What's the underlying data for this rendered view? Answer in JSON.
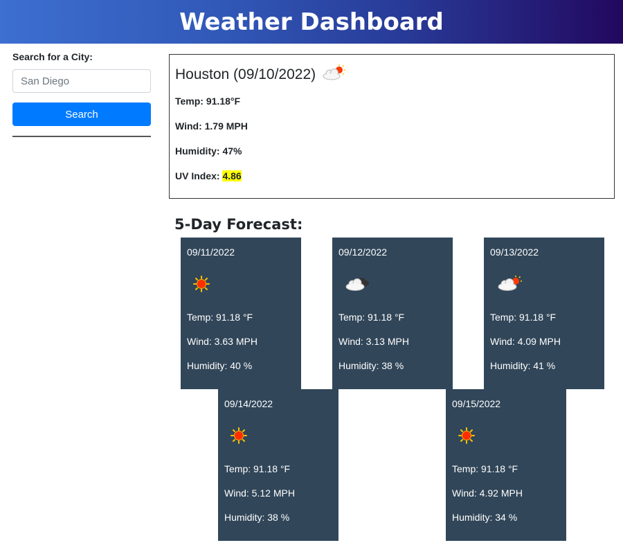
{
  "header": {
    "title": "Weather Dashboard"
  },
  "sidebar": {
    "search_label": "Search for a City:",
    "search_placeholder": "San Diego",
    "search_button": "Search"
  },
  "current": {
    "city_date": "Houston (09/10/2022)",
    "icon": "partly-cloudy-icon",
    "temp": "Temp: 91.18°F",
    "wind": "Wind: 1.79 MPH",
    "humidity": "Humidity: 47%",
    "uv_label": "UV Index: ",
    "uv_value": "4.86",
    "uv_color": "#ffff00"
  },
  "forecast": {
    "title": "5-Day Forecast:",
    "card_color": "#314659",
    "days": [
      {
        "date": "09/11/2022",
        "icon": "sun-icon",
        "temp": "Temp: 91.18 °F",
        "wind": "Wind: 3.63 MPH",
        "humidity": "Humidity: 40 %"
      },
      {
        "date": "09/12/2022",
        "icon": "cloud-icon",
        "temp": "Temp: 91.18 °F",
        "wind": "Wind: 3.13 MPH",
        "humidity": "Humidity: 38 %"
      },
      {
        "date": "09/13/2022",
        "icon": "partly-cloudy-icon",
        "temp": "Temp: 91.18 °F",
        "wind": "Wind: 4.09 MPH",
        "humidity": "Humidity: 41 %"
      },
      {
        "date": "09/14/2022",
        "icon": "sun-icon",
        "temp": "Temp: 91.18 °F",
        "wind": "Wind: 5.12 MPH",
        "humidity": "Humidity: 38 %"
      },
      {
        "date": "09/15/2022",
        "icon": "sun-icon",
        "temp": "Temp: 91.18 °F",
        "wind": "Wind: 4.92 MPH",
        "humidity": "Humidity: 34 %"
      }
    ]
  }
}
